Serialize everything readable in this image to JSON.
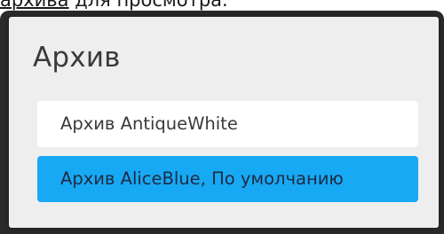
{
  "caption": {
    "text_part1": "архива",
    "text_part2": " для просмотра."
  },
  "dialog": {
    "title": "Архив",
    "options": [
      {
        "label": "Архив AntiqueWhite",
        "selected": false
      },
      {
        "label": "Архив AliceBlue, По умолчанию",
        "selected": true
      }
    ]
  },
  "colors": {
    "selected_bg": "#17a9f3",
    "option_bg": "#ffffff",
    "dialog_bg": "#eeeeef",
    "frame_bg": "#2a2a2a"
  }
}
